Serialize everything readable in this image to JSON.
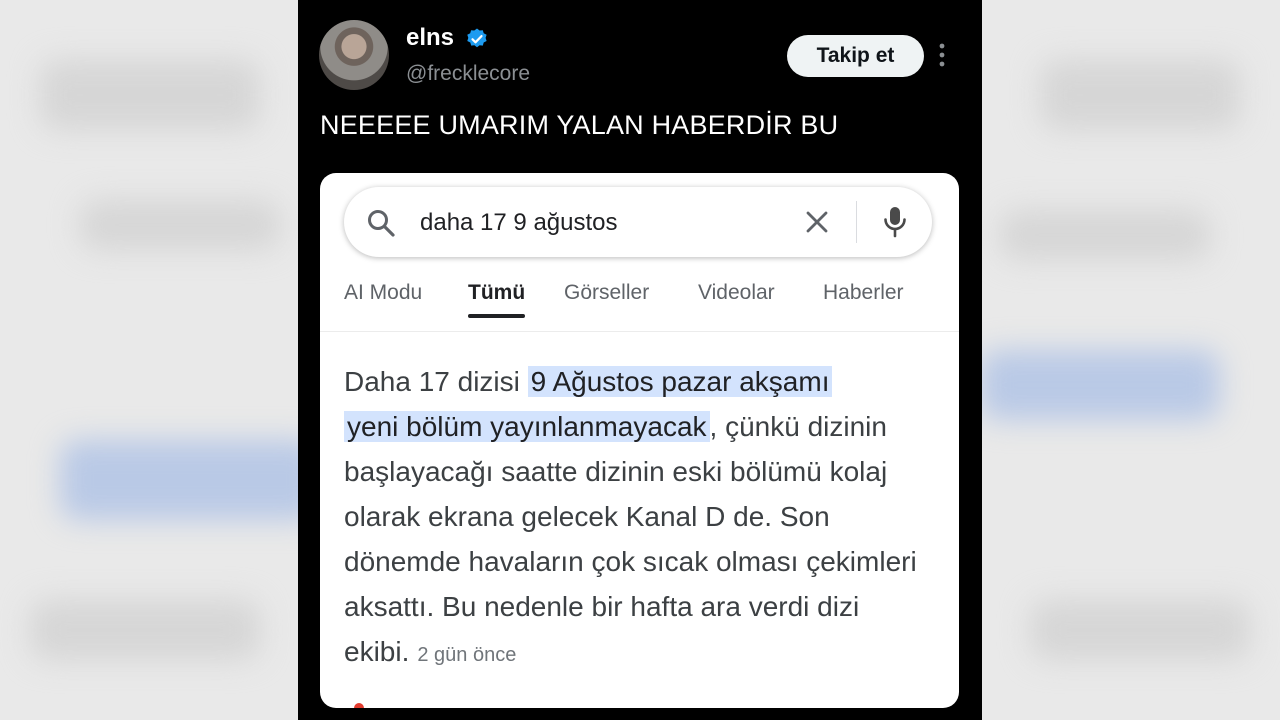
{
  "post": {
    "display_name": "elns",
    "handle": "@frecklecore",
    "follow_label": "Takip et",
    "text": "NEEEEE UMARIM YALAN HABERDİR BU",
    "verified_color": "#1d9bf0"
  },
  "embedded_search": {
    "query": "daha 17 9 ağustos",
    "tabs": [
      {
        "label": "AI Modu",
        "active": false
      },
      {
        "label": "Tümü",
        "active": true
      },
      {
        "label": "Görseller",
        "active": false
      },
      {
        "label": "Videolar",
        "active": false
      },
      {
        "label": "Haberler",
        "active": false
      }
    ],
    "snippet": {
      "prefix": "Daha 17 dizisi ",
      "highlight_line1": "9 Ağustos pazar akşamı",
      "highlight_line2": "yeni bölüm yayınlanmayacak",
      "rest": ", çünkü dizinin başlayacağı saatte dizinin eski bölümü kolaj olarak ekrana gelecek Kanal D de. Son dönemde havaların çok sıcak olması çekimleri aksattı. Bu nedenle bir hafta ara verdi dizi ekibi.",
      "time_ago": "2 gün önce",
      "highlight_color": "#d3e3fd"
    }
  },
  "icons": [
    "verified-badge-icon",
    "more-options-icon",
    "search-icon",
    "clear-icon",
    "microphone-icon"
  ]
}
